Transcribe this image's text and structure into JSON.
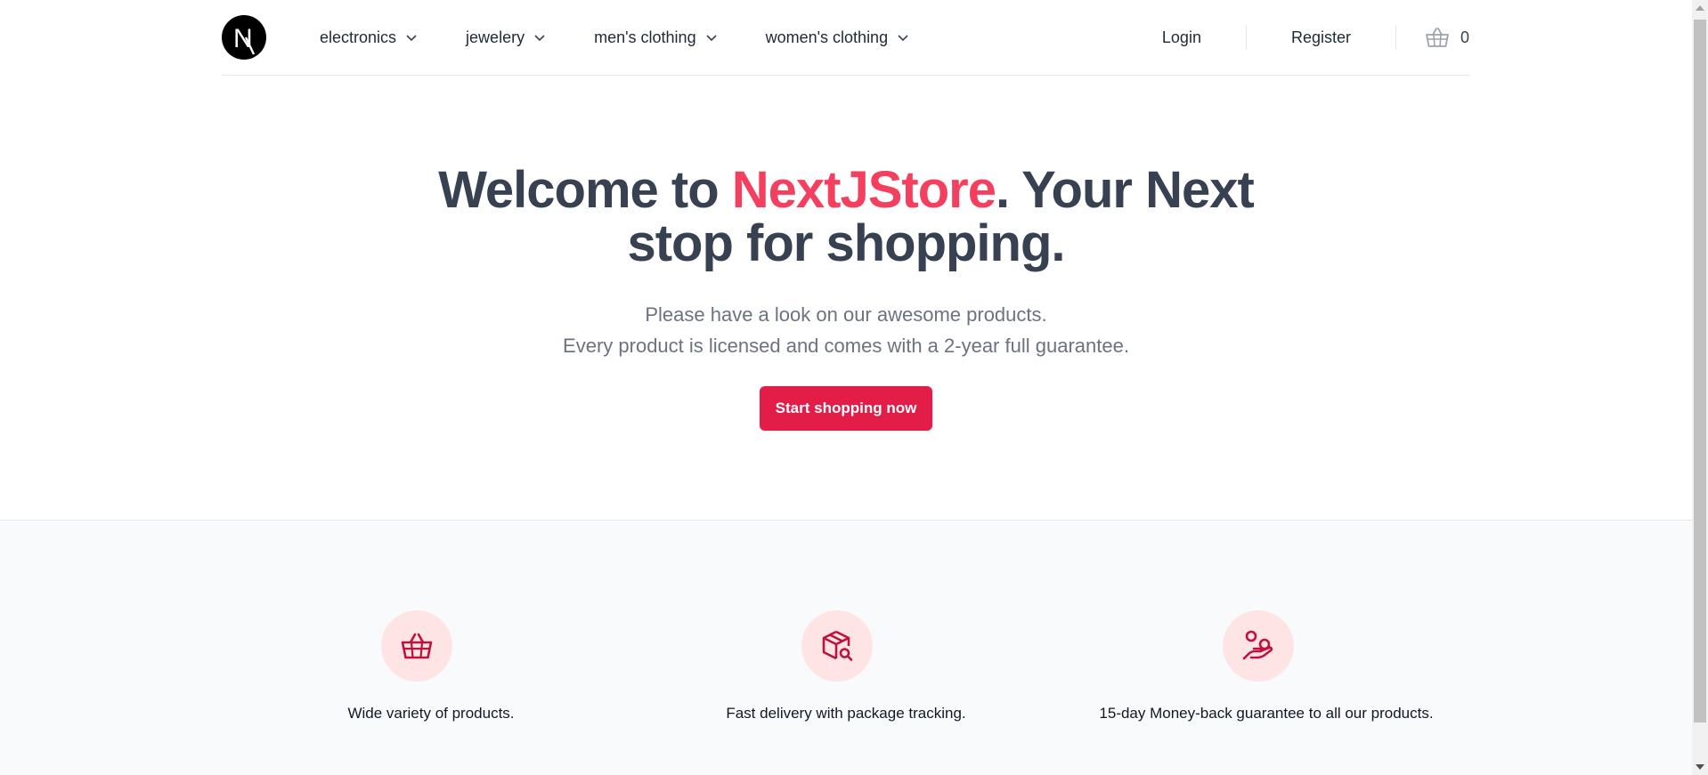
{
  "header": {
    "logo_letter": "N",
    "nav": [
      {
        "label": "electronics"
      },
      {
        "label": "jewelery"
      },
      {
        "label": "men's clothing"
      },
      {
        "label": "women's clothing"
      }
    ],
    "login_label": "Login",
    "register_label": "Register",
    "cart_count": "0"
  },
  "hero": {
    "title_prefix": "Welcome to ",
    "title_brand": "NextJStore",
    "title_suffix_line1": ". Your Next",
    "title_line2": "stop for shopping.",
    "subtitle_line1": "Please have a look on our awesome products.",
    "subtitle_line2": "Every product is licensed and comes with a 2-year full guarantee.",
    "cta_label": "Start shopping now"
  },
  "features": [
    {
      "icon": "basket-icon",
      "label": "Wide variety of products."
    },
    {
      "icon": "package-search-icon",
      "label": "Fast delivery with package tracking."
    },
    {
      "icon": "hand-money-icon",
      "label": "15-day Money-back guarantee to all our products."
    }
  ],
  "colors": {
    "brand": "#f43f5e",
    "cta": "#e11d48",
    "heading": "#374151",
    "feature_circle": "#ffe4e6",
    "feature_icon": "#be123c"
  }
}
